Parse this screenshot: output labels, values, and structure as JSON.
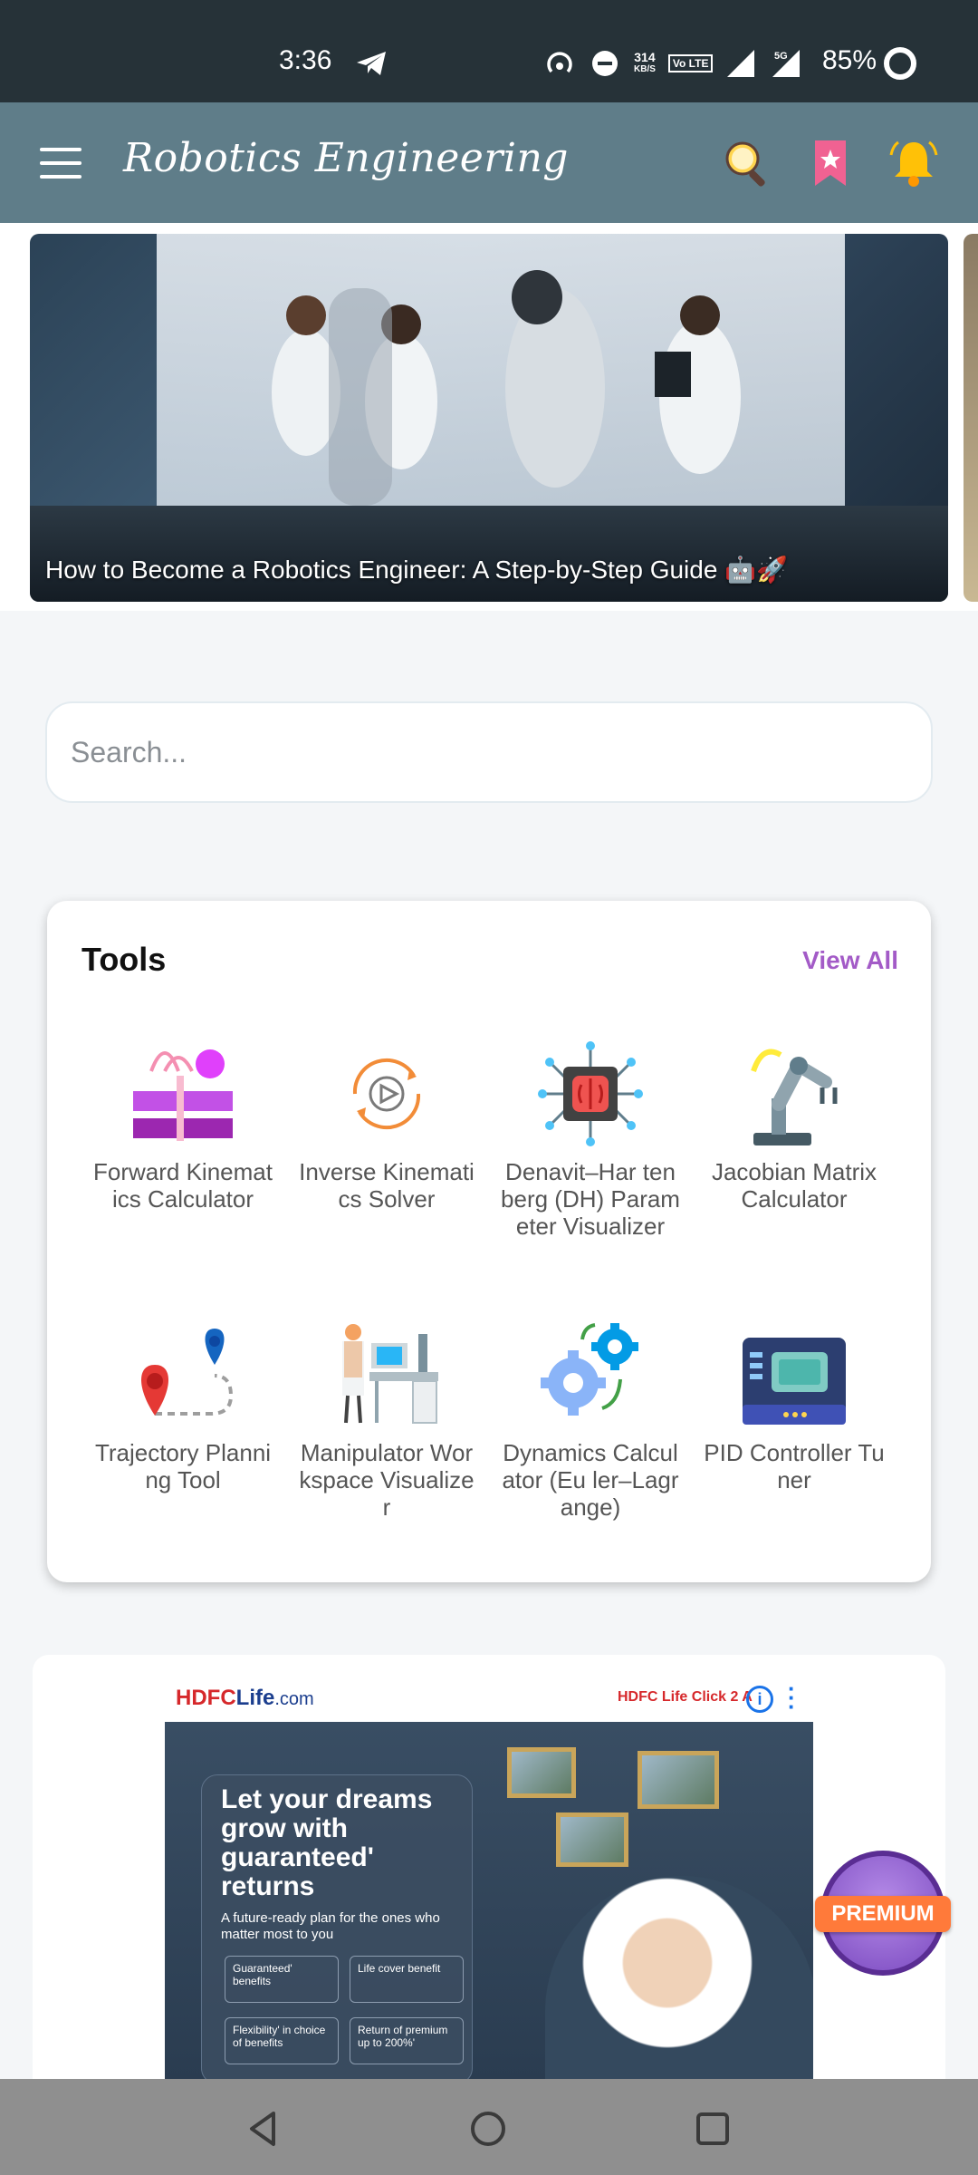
{
  "status_bar": {
    "time": "3:36",
    "network_speed_value": "314",
    "network_speed_unit": "KB/S",
    "volte": "Vo LTE",
    "network_type": "5G",
    "battery": "85%"
  },
  "app_bar": {
    "title": "Robotics Engineering"
  },
  "banner": {
    "caption": "How to Become a Robotics Engineer: A Step-by-Step Guide 🤖🚀"
  },
  "search": {
    "placeholder": "Search..."
  },
  "tools": {
    "title": "Tools",
    "view_all": "View All",
    "items": [
      {
        "label": "Forward Kinematics Calculator",
        "icon": "stacked-blocks-icon"
      },
      {
        "label": "Inverse Kinematics Solver",
        "icon": "play-cycle-icon"
      },
      {
        "label": "Denavit–Har tenberg (DH) Parameter Visualizer",
        "icon": "chip-brain-icon"
      },
      {
        "label": "Jacobian Matrix Calculator",
        "icon": "robot-arm-icon"
      },
      {
        "label": "Trajectory Planning Tool",
        "icon": "route-pins-icon"
      },
      {
        "label": "Manipulator Workspace Visualizer",
        "icon": "workstation-icon"
      },
      {
        "label": "Dynamics Calculator (Eu ler–Lagrange)",
        "icon": "gears-icon"
      },
      {
        "label": "PID Controller Tuner",
        "icon": "control-panel-icon"
      }
    ]
  },
  "ad": {
    "logo_red": "HDFC",
    "logo_blue": "Life",
    "logo_suffix": ".com",
    "click2": "HDFC Life Click 2 A",
    "headline": "Let your dreams grow with guaranteed' returns",
    "sub": "A future-ready plan for the ones who matter most to you",
    "pills": [
      "Guaranteed' benefits",
      "Life cover benefit",
      "Flexibility' in choice of benefits",
      "Return of premium up to 200%'"
    ]
  },
  "premium": {
    "label": "PREMIUM"
  },
  "colors": {
    "status_bar": "#263238",
    "app_bar": "#5f7d89",
    "accent": "#a35bc7",
    "premium": "#ff7a3a"
  }
}
